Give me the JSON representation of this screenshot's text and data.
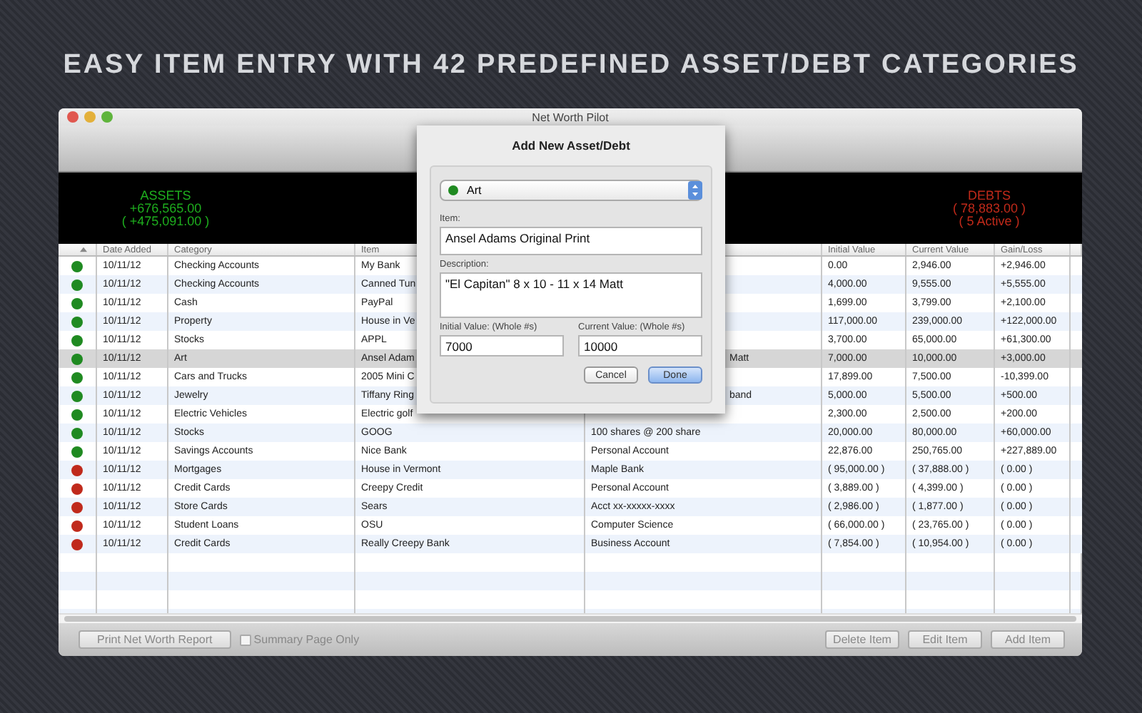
{
  "headline": "EASY ITEM ENTRY WITH 42 PREDEFINED ASSET/DEBT CATEGORIES",
  "window": {
    "title": "Net Worth Pilot"
  },
  "summary": {
    "assets": {
      "label": "ASSETS",
      "total": "+676,565.00",
      "change": "( +475,091.00 )"
    },
    "debts": {
      "label": "DEBTS",
      "total": "( 78,883.00 )",
      "active": "( 5 Active )"
    }
  },
  "table": {
    "headers": {
      "date": "Date Added",
      "category": "Category",
      "item": "Item",
      "initial": "Initial Value",
      "current": "Current Value",
      "gain": "Gain/Loss"
    },
    "rows": [
      {
        "color": "#1f8a21",
        "selected": false,
        "date": "10/11/12",
        "category": "Checking Accounts",
        "item": "My Bank",
        "initial": "0.00",
        "current": "2,946.00",
        "gain": "+2,946.00"
      },
      {
        "color": "#1f8a21",
        "selected": false,
        "date": "10/11/12",
        "category": "Checking Accounts",
        "item": "Canned Tun",
        "initial": "4,000.00",
        "current": "9,555.00",
        "gain": "+5,555.00"
      },
      {
        "color": "#1f8a21",
        "selected": false,
        "date": "10/11/12",
        "category": "Cash",
        "item": "PayPal",
        "initial": "1,699.00",
        "current": "3,799.00",
        "gain": "+2,100.00"
      },
      {
        "color": "#1f8a21",
        "selected": false,
        "date": "10/11/12",
        "category": "Property",
        "item": "House in Ve",
        "initial": "117,000.00",
        "current": "239,000.00",
        "gain": "+122,000.00"
      },
      {
        "color": "#1f8a21",
        "selected": false,
        "date": "10/11/12",
        "category": "Stocks",
        "item": "APPL",
        "initial": "3,700.00",
        "current": "65,000.00",
        "gain": "+61,300.00"
      },
      {
        "color": "#1f8a21",
        "selected": true,
        "date": "10/11/12",
        "category": "Art",
        "item": "Ansel Adam",
        "description": "Matt",
        "description_cut": true,
        "initial": "7,000.00",
        "current": "10,000.00",
        "gain": "+3,000.00"
      },
      {
        "color": "#1f8a21",
        "selected": false,
        "date": "10/11/12",
        "category": "Cars and Trucks",
        "item": "2005 Mini C",
        "initial": "17,899.00",
        "current": "7,500.00",
        "gain": "-10,399.00"
      },
      {
        "color": "#1f8a21",
        "selected": false,
        "date": "10/11/12",
        "category": "Jewelry",
        "item": "Tiffany Ring",
        "description": "band",
        "description_cut": true,
        "initial": "5,000.00",
        "current": "5,500.00",
        "gain": "+500.00"
      },
      {
        "color": "#1f8a21",
        "selected": false,
        "date": "10/11/12",
        "category": "Electric Vehicles",
        "item": "Electric golf",
        "initial": "2,300.00",
        "current": "2,500.00",
        "gain": "+200.00"
      },
      {
        "color": "#1f8a21",
        "selected": false,
        "date": "10/11/12",
        "category": "Stocks",
        "item": "GOOG",
        "description": "100 shares @ 200 share",
        "description_cut": false,
        "initial": "20,000.00",
        "current": "80,000.00",
        "gain": "+60,000.00"
      },
      {
        "color": "#1f8a21",
        "selected": false,
        "date": "10/11/12",
        "category": "Savings Accounts",
        "item": "Nice Bank",
        "description": "Personal Account",
        "description_cut": false,
        "initial": "22,876.00",
        "current": "250,765.00",
        "gain": "+227,889.00"
      },
      {
        "color": "#c02a1c",
        "selected": false,
        "date": "10/11/12",
        "category": "Mortgages",
        "item": "House in Vermont",
        "description": "Maple Bank",
        "description_cut": false,
        "initial": "( 95,000.00 )",
        "current": "( 37,888.00 )",
        "gain": "( 0.00 )"
      },
      {
        "color": "#c02a1c",
        "selected": false,
        "date": "10/11/12",
        "category": "Credit Cards",
        "item": "Creepy Credit",
        "description": "Personal Account",
        "description_cut": false,
        "initial": "( 3,889.00 )",
        "current": "( 4,399.00 )",
        "gain": "( 0.00 )"
      },
      {
        "color": "#c02a1c",
        "selected": false,
        "date": "10/11/12",
        "category": "Store Cards",
        "item": "Sears",
        "description": "Acct xx-xxxxx-xxxx",
        "description_cut": false,
        "initial": "( 2,986.00 )",
        "current": "( 1,877.00 )",
        "gain": "( 0.00 )"
      },
      {
        "color": "#c02a1c",
        "selected": false,
        "date": "10/11/12",
        "category": "Student Loans",
        "item": "OSU",
        "description": "Computer Science",
        "description_cut": false,
        "initial": "( 66,000.00 )",
        "current": "( 23,765.00 )",
        "gain": "( 0.00 )"
      },
      {
        "color": "#c02a1c",
        "selected": false,
        "date": "10/11/12",
        "category": "Credit Cards",
        "item": "Really Creepy Bank",
        "description": "Business Account",
        "description_cut": false,
        "initial": "( 7,854.00 )",
        "current": "( 10,954.00 )",
        "gain": "( 0.00 )"
      }
    ]
  },
  "bottom_bar": {
    "print_button": "Print Net Worth Report",
    "summary_checkbox": {
      "label": "Summary Page Only",
      "checked": false
    },
    "buttons": [
      "Delete Item",
      "Edit Item",
      "Add Item"
    ]
  },
  "dialog": {
    "title": "Add New Asset/Debt",
    "category": {
      "label": "Art",
      "color": "#1f8a21"
    },
    "item_label": "Item:",
    "item_value": "Ansel Adams Original Print",
    "description_label": "Description:",
    "description_value": "\"El Capitan\" 8 x 10 - 11 x 14 Matt",
    "initial_label": "Initial Value: (Whole #s)",
    "initial_value": "7000",
    "current_label": "Current Value: (Whole #s)",
    "current_value": "10000",
    "cancel": "Cancel",
    "done": "Done"
  }
}
